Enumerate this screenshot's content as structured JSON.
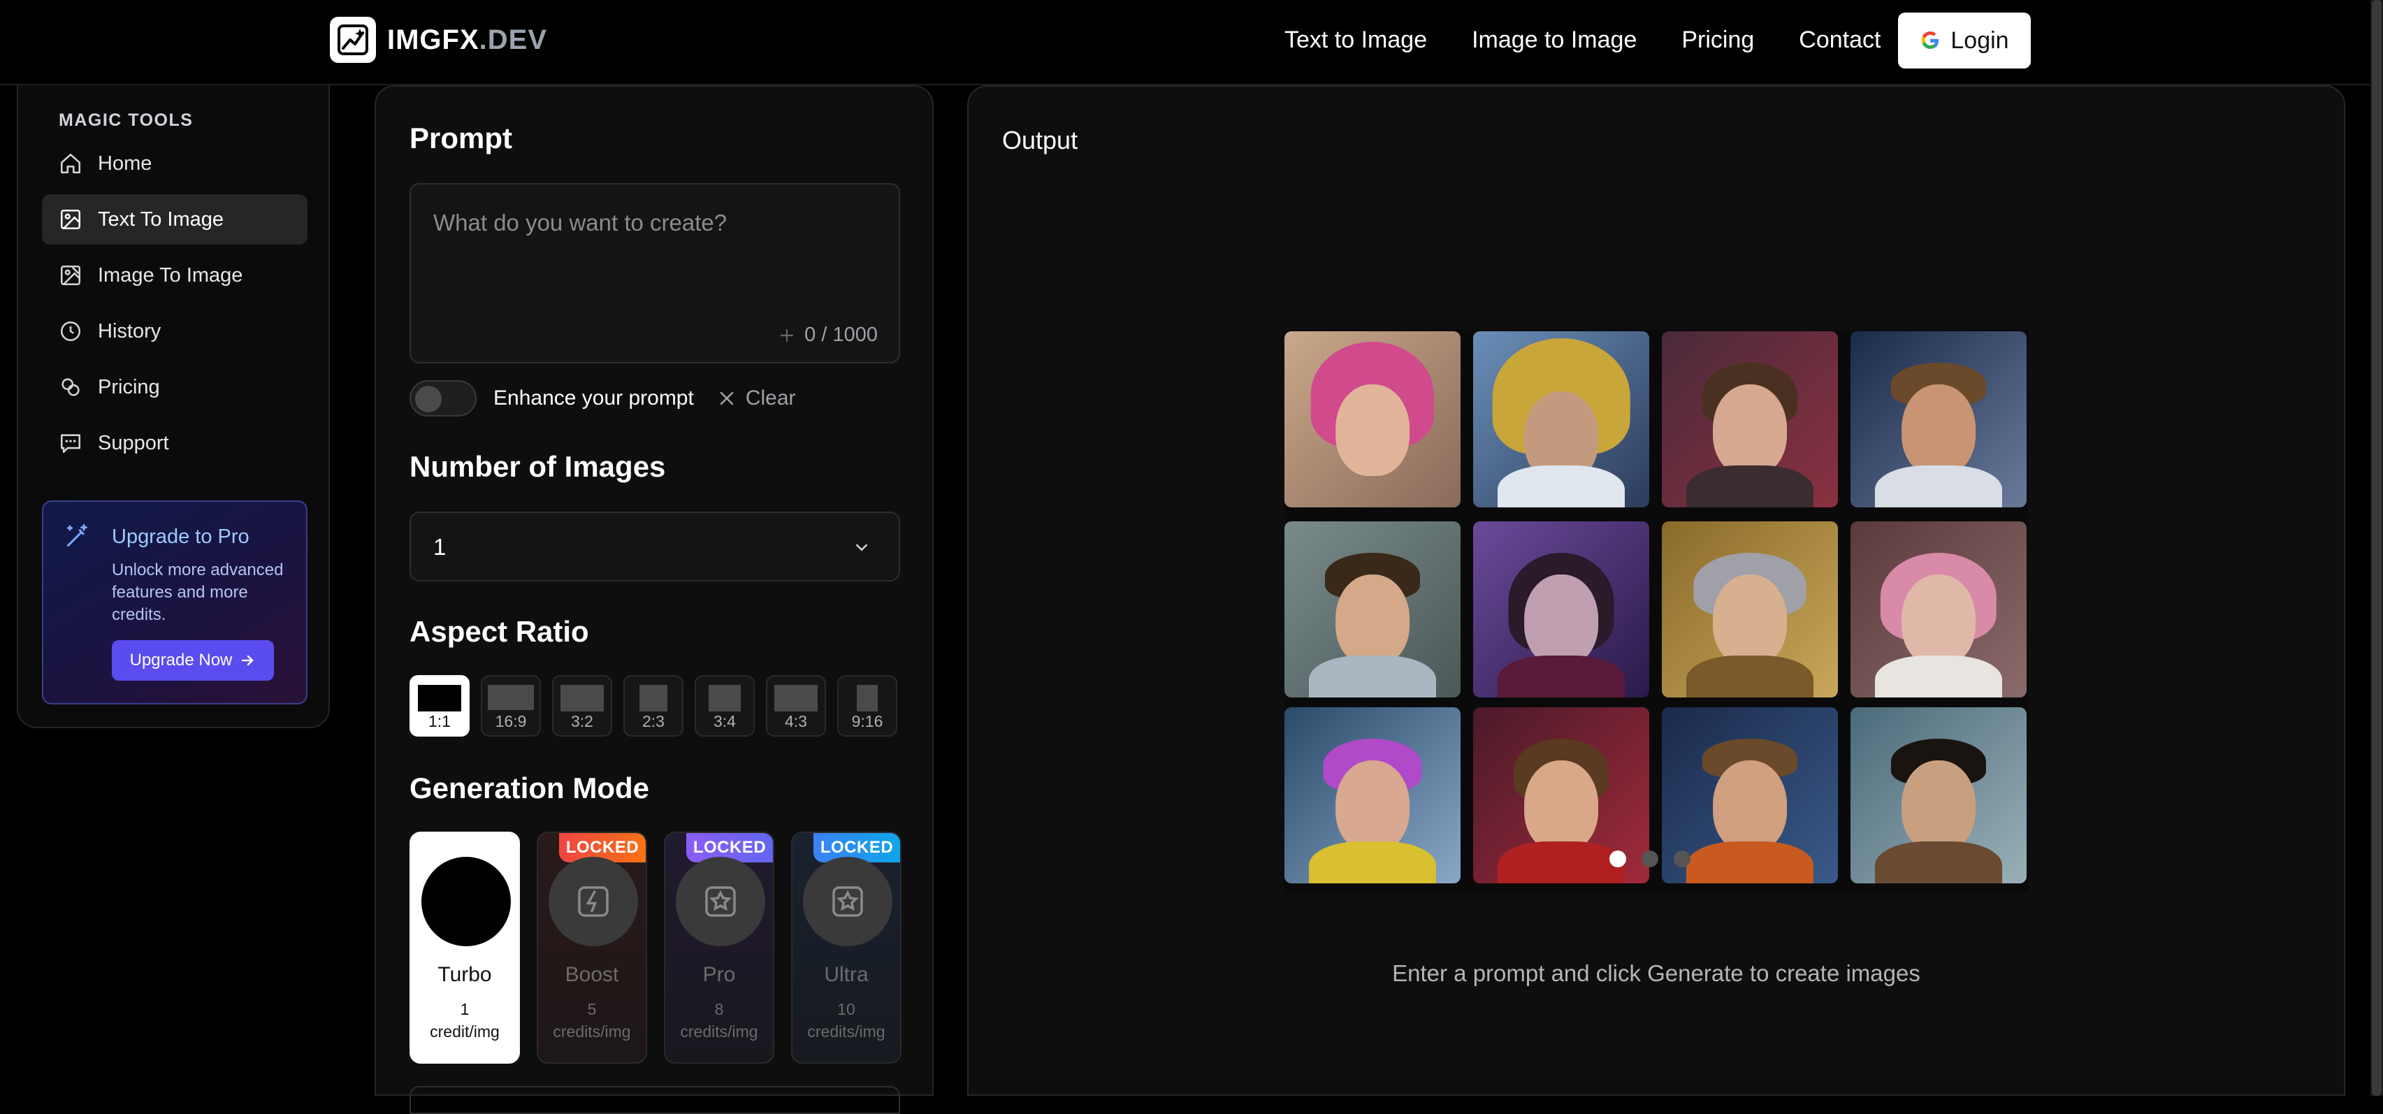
{
  "header": {
    "logo_main": "IMGFX",
    "logo_suffix": ".DEV",
    "nav": [
      "Text to Image",
      "Image to Image",
      "Pricing",
      "Contact"
    ],
    "login_label": "Login"
  },
  "sidebar": {
    "title": "MAGIC TOOLS",
    "items": [
      {
        "label": "Home",
        "icon": "home-icon"
      },
      {
        "label": "Text To Image",
        "icon": "image-icon",
        "active": true
      },
      {
        "label": "Image To Image",
        "icon": "image-edit-icon"
      },
      {
        "label": "History",
        "icon": "clock-icon"
      },
      {
        "label": "Pricing",
        "icon": "coins-icon"
      },
      {
        "label": "Support",
        "icon": "chat-icon"
      }
    ],
    "upgrade": {
      "title": "Upgrade to Pro",
      "text": "Unlock more advanced features and more credits.",
      "button": "Upgrade Now"
    }
  },
  "prompt": {
    "heading": "Prompt",
    "placeholder": "What do you want to create?",
    "counter": "0 / 1000",
    "enhance_label": "Enhance your prompt",
    "enhance_on": false,
    "clear_label": "Clear"
  },
  "images": {
    "heading": "Number of Images",
    "selected": "1"
  },
  "aspect": {
    "heading": "Aspect Ratio",
    "options": [
      "1:1",
      "16:9",
      "3:2",
      "2:3",
      "3:4",
      "4:3",
      "9:16"
    ],
    "selected": "1:1"
  },
  "generation": {
    "heading": "Generation Mode",
    "modes": [
      {
        "name": "Turbo",
        "credits": "1",
        "unit": "credit/img",
        "locked": false
      },
      {
        "name": "Boost",
        "credits": "5",
        "unit": "credits/img",
        "locked": true
      },
      {
        "name": "Pro",
        "credits": "8",
        "unit": "credits/img",
        "locked": true
      },
      {
        "name": "Ultra",
        "credits": "10",
        "unit": "credits/img",
        "locked": true
      }
    ],
    "locked_label": "LOCKED"
  },
  "output": {
    "heading": "Output",
    "message": "Enter a prompt and click Generate to create images",
    "carousel_pages": 3,
    "carousel_active": 1
  },
  "colors": {
    "accent": "#5b4cf0",
    "boost": "#f97316",
    "pro": "#8b5cf6",
    "ultra": "#3b82f6"
  }
}
